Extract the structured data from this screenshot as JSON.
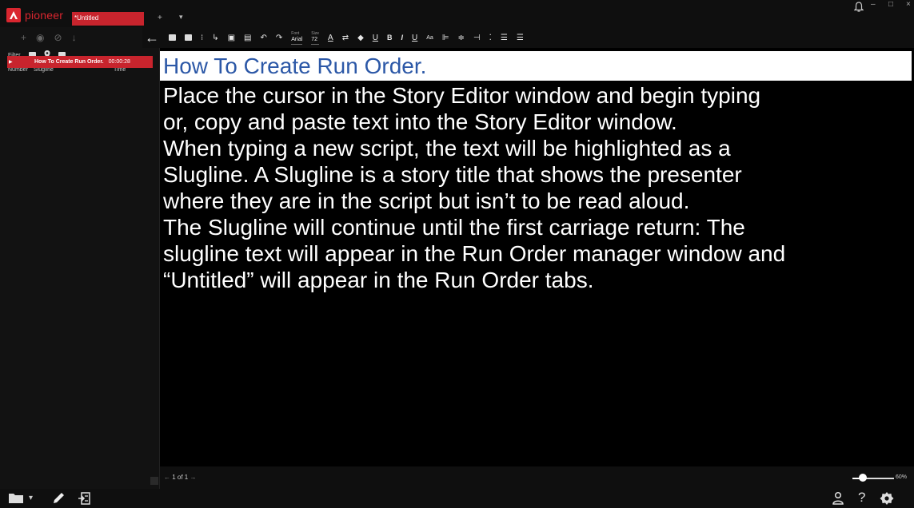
{
  "app": {
    "brand": "pioneer",
    "active_tab": "*Untitled",
    "new_tab": "+",
    "tab_menu": "▾",
    "window_controls": [
      "–",
      "□",
      "×"
    ]
  },
  "left_panel": {
    "filter_label": "Filter",
    "columns": {
      "number": "Number",
      "slugline": "Slugline",
      "time": "Time"
    },
    "rows": [
      {
        "slugline": "How To Create Run Order.",
        "time": "00:00:28",
        "selected": true
      }
    ]
  },
  "toolbar": {
    "font_caption": "Font",
    "font_value": "Arial",
    "size_caption": "Size",
    "size_value": "72",
    "bold": "B",
    "italic": "I",
    "underline": "U",
    "case": "Aa",
    "text_color_letter": "A",
    "highlight_color": "#e6e6e6"
  },
  "editor": {
    "slugline": "How To Create Run Order.",
    "body": "Place the cursor in the Story Editor window and begin typing\nor, copy and paste text into the Story Editor window.\nWhen typing a new script, the text will be highlighted as a\nSlugline. A Slugline is a story title that shows the presenter\nwhere they are in the script but isn’t to be read aloud.\nThe Slugline will continue until the first carriage return: The\nslugline text will appear in the Run Order manager window and\n“Untitled” will appear in the Run Order tabs.",
    "slugline_color": "#2c58a7",
    "text_color": "#ffffff"
  },
  "footer": {
    "pager_prev": "←",
    "pager_text": "1 of 1",
    "pager_next": "→",
    "zoom_label": "60%",
    "zoom_level": 0.2
  },
  "colors": {
    "accent": "#c8242d",
    "background": "#000000",
    "panel": "#121212"
  },
  "icons": [
    "pioneer-logo-icon",
    "bell-icon",
    "add-icon",
    "record-icon",
    "hide-icon",
    "download-icon",
    "back-arrow-icon",
    "save-icon",
    "grid-icon",
    "folder-icon",
    "user-icon",
    "help-icon",
    "settings-icon"
  ]
}
